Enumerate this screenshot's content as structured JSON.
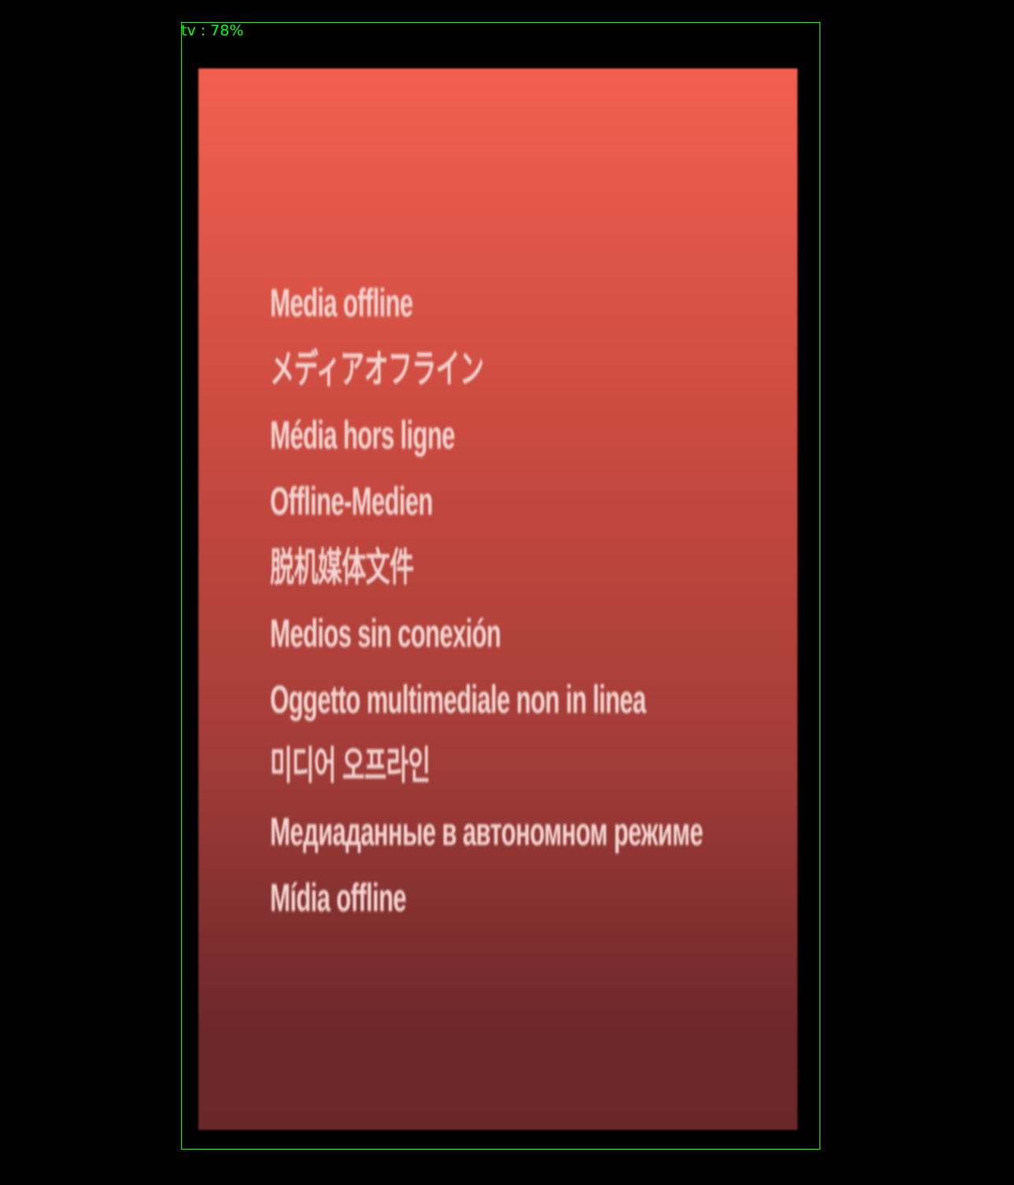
{
  "detection": {
    "label": "tv : 78%"
  },
  "media_offline": {
    "lines": [
      "Media offline",
      "メディアオフライン",
      "Média hors ligne",
      "Offline-Medien",
      "脱机媒体文件",
      "Medios sin conexión",
      "Oggetto multimediale non in linea",
      "미디어 오프라인",
      "Медиаданные в автономном режиме",
      "Mídia offline"
    ]
  },
  "colors": {
    "panel_top": "#f2604f",
    "panel_bottom": "#6a272a",
    "detection": "#00ff00"
  }
}
